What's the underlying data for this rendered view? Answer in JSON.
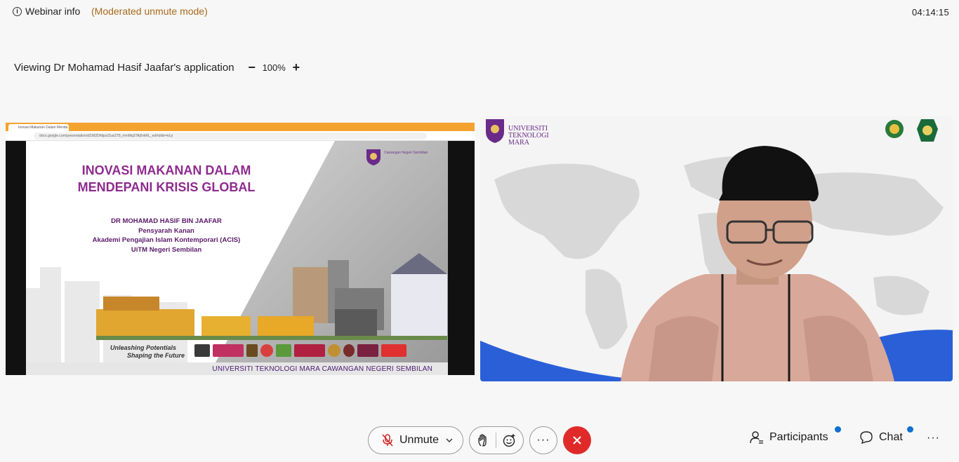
{
  "header": {
    "webinar_info_label": "Webinar info",
    "mode_label": "(Moderated unmute mode)",
    "timer": "04:14:15"
  },
  "viewing": {
    "text": "Viewing Dr Mohamad Hasif Jaafar's application",
    "zoom_out": "−",
    "zoom_level": "100%",
    "zoom_in": "+"
  },
  "shared_screen": {
    "browser_tab_title": "Inovasi Makanan Dalam Menda...",
    "browser_url": "docs.google.com/presentation/d/1M2Dhttps/ZuaST8_mmMq3TAj0vkRL_ed#slide=id.p",
    "slide": {
      "title_line1": "INOVASI MAKANAN DALAM",
      "title_line2": "MENDEPANI KRISIS GLOBAL",
      "presenter_name": "DR MOHAMAD HASIF BIN JAAFAR",
      "presenter_role": "Pensyarah Kanan",
      "presenter_dept": "Akademi Pengajian Islam Kontemporari (ACIS)",
      "presenter_campus": "UiTM Negeri Sembilan",
      "slogan_line1": "Unleashing Potentials",
      "slogan_line2": "Shaping the Future",
      "footer": "UNIVERSITI TEKNOLOGI MARA CAWANGAN NEGERI SEMBILAN",
      "uitm_badge_text": "Cawangan Negeri Sembilan"
    }
  },
  "camera": {
    "logo_line1": "UNIVERSITI",
    "logo_line2": "TEKNOLOGI",
    "logo_line3": "MARA"
  },
  "controls": {
    "unmute_label": "Unmute",
    "more_label": "···",
    "participants_label": "Participants",
    "chat_label": "Chat",
    "overflow_label": "···"
  },
  "colors": {
    "leave_button": "#e02a2a",
    "notification_dot": "#1170cf",
    "mode_text": "#a86a1a",
    "slide_title": "#8e2b8e"
  }
}
